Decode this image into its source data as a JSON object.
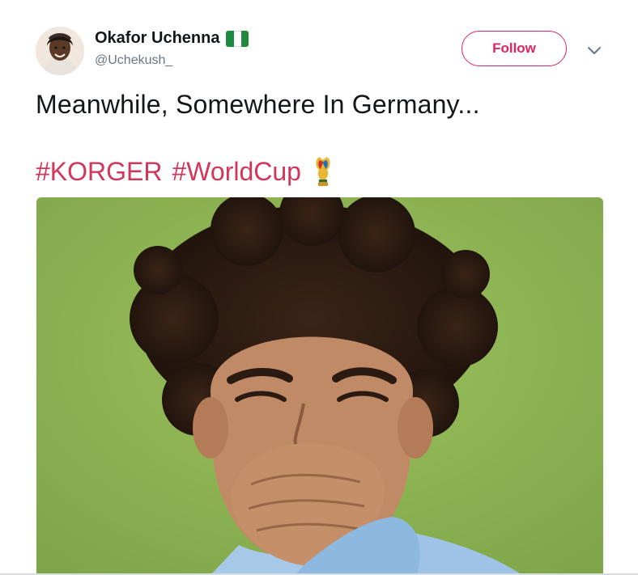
{
  "user": {
    "display_name": "Okafor Uchenna",
    "handle": "@Uchekush_",
    "badge_icon": "nigeria-flag-icon",
    "flag_colors": [
      "#1f8a3b",
      "#ffffff",
      "#1f8a3b"
    ]
  },
  "actions": {
    "follow_label": "Follow",
    "menu_icon": "chevron-down-icon"
  },
  "tweet": {
    "text": "Meanwhile, Somewhere In Germany...",
    "hashtags": [
      "#KORGER",
      "#WorldCup"
    ],
    "emoji_icon": "world-cup-trophy-icon"
  },
  "media": {
    "icon": "photo-smiling-man-covering-mouth"
  },
  "colors": {
    "accent": "#e0245e",
    "hashtag": "#d2365a",
    "handle": "#657786",
    "text": "#14171a",
    "grass": "#8fb653"
  }
}
